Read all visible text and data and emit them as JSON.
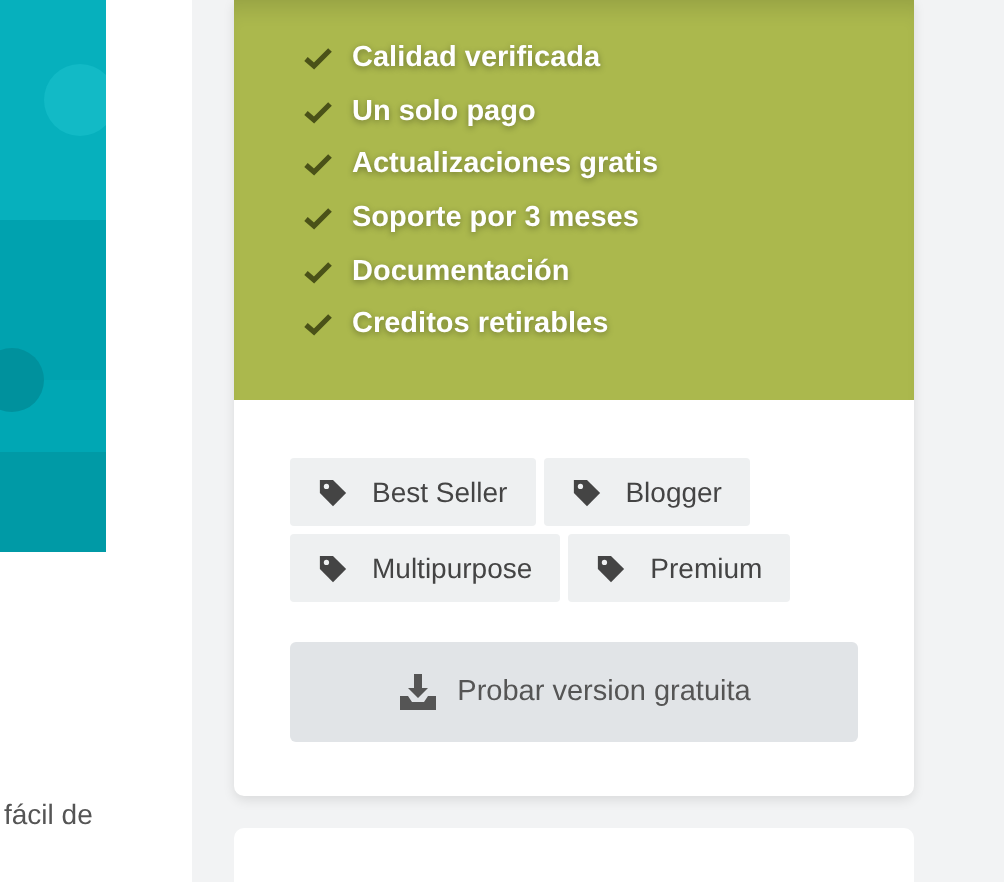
{
  "sidebar": {
    "text_fragment": "fácil de"
  },
  "features": [
    {
      "label": "Calidad verificada",
      "checked": true
    },
    {
      "label": "Un solo pago",
      "checked": true
    },
    {
      "label": "Actualizaciones gratis",
      "checked": true
    },
    {
      "label": "Soporte por 3 meses",
      "checked": true
    },
    {
      "label": "Documentación",
      "checked": true
    },
    {
      "label": "Creditos retirables",
      "checked": true
    }
  ],
  "tags": [
    [
      "Best Seller",
      "Blogger"
    ],
    [
      "Multipurpose",
      "Premium"
    ]
  ],
  "trial_button": "Probar version gratuita"
}
